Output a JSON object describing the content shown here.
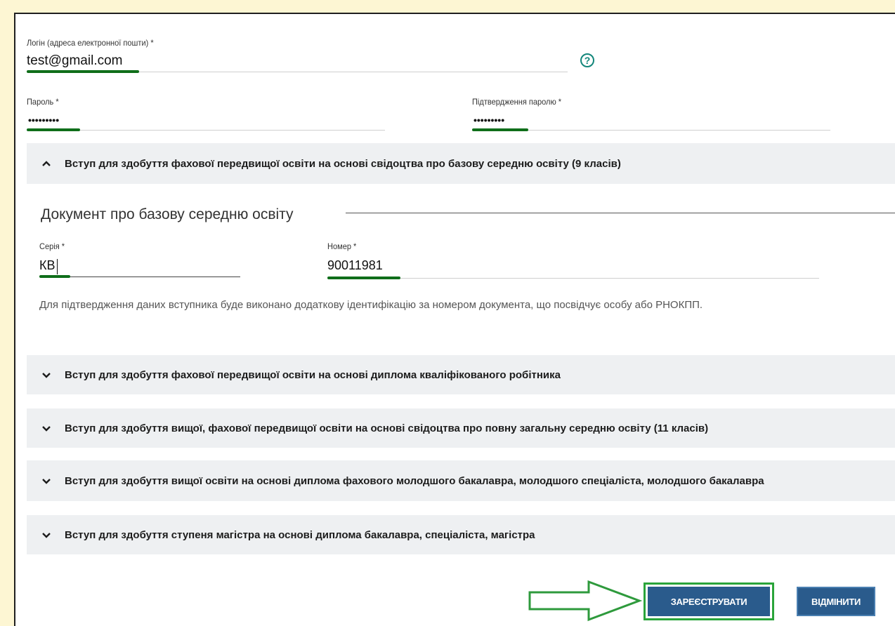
{
  "form": {
    "login": {
      "label": "Логін (адреса електронної пошти) *",
      "value": "test@gmail.com",
      "help_icon": "question-circle-icon"
    },
    "password": {
      "label": "Пароль *",
      "value": "•••••••••"
    },
    "password_confirm": {
      "label": "Підтвердження паролю *",
      "value": "•••••••••"
    }
  },
  "accordions": [
    {
      "title": "Вступ для здобуття фахової передвищої освіти на основі свідоцтва про базову середню освіту (9 класів)",
      "expanded": true
    },
    {
      "title": "Вступ для здобуття фахової передвищої освіти на основі диплома кваліфікованого робітника",
      "expanded": false
    },
    {
      "title": "Вступ для здобуття вищої, фахової передвищої освіти на основі свідоцтва про повну загальну середню освіту (11 класів)",
      "expanded": false
    },
    {
      "title": "Вступ для здобуття вищої освіти на основі диплома фахового молодшого бакалавра, молодшого спеціаліста, молодшого бакалавра",
      "expanded": false
    },
    {
      "title": "Вступ для здобуття ступеня магістра на основі диплома бакалавра, спеціаліста, магістра",
      "expanded": false
    }
  ],
  "document": {
    "title": "Документ про базову середню освіту",
    "series": {
      "label": "Серія *",
      "value": "КВ"
    },
    "number": {
      "label": "Номер *",
      "value": "90011981"
    },
    "note": "Для підтвердження даних вступника буде виконано додаткову ідентифікацію за номером документа, що посвідчує особу або РНОКПП."
  },
  "actions": {
    "register_label": "ЗАРЕЄСТРУВАТИ",
    "cancel_label": "ВІДМІНИТИ"
  },
  "colors": {
    "highlight_green": "#0f6e1a",
    "button_blue": "#2a5b8c",
    "accordion_bg": "#eef0f2",
    "page_bg": "#fdf6d3"
  }
}
